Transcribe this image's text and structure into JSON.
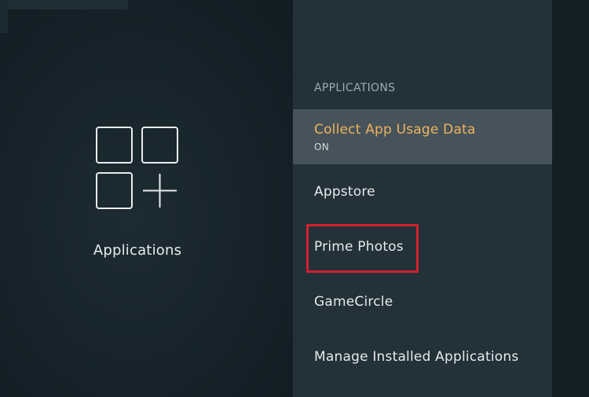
{
  "category": {
    "label": "Applications",
    "icon": "applications-grid-plus-icon"
  },
  "panel": {
    "header": "APPLICATIONS",
    "items": [
      {
        "label": "Collect App Usage Data",
        "sub": "ON",
        "selected": true
      },
      {
        "label": "Appstore"
      },
      {
        "label": "Prime Photos",
        "highlighted": true
      },
      {
        "label": "GameCircle"
      },
      {
        "label": "Manage Installed Applications"
      }
    ]
  },
  "colors": {
    "selected_text": "#f0b35e",
    "highlight_border": "#d4202f",
    "selected_bg": "#46535a"
  }
}
